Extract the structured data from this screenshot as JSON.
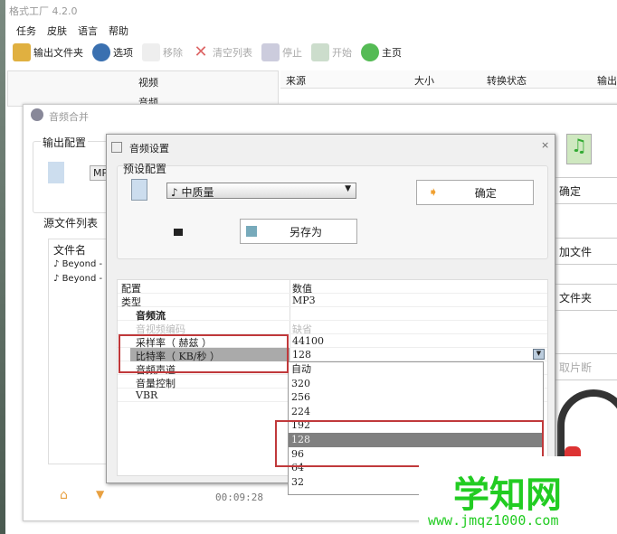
{
  "app": {
    "title": "格式工厂 4.2.0",
    "menu": [
      "任务",
      "皮肤",
      "语言",
      "帮助"
    ],
    "toolbar": {
      "output_folder": "输出文件夹",
      "options": "选项",
      "remove": "移除",
      "clear_list": "清空列表",
      "stop": "停止",
      "start": "开始",
      "home": "主页"
    },
    "left_pane": {
      "video": "视频",
      "audio": "音频"
    },
    "table_headers": [
      "来源",
      "大小",
      "转换状态",
      "输出"
    ]
  },
  "merge": {
    "title": "音频合并",
    "output_config": "输出配置",
    "format_short": "MP",
    "source_list": "源文件列表",
    "file_name_header": "文件名",
    "files": [
      "Beyond -",
      "Beyond -"
    ],
    "duration": "00:09:28",
    "right_buttons": [
      "确定",
      "加文件",
      "文件夹",
      "取片断"
    ]
  },
  "dialog": {
    "title": "音频设置",
    "close": "×",
    "preset_group": "预设配置",
    "preset_value": "♪ 中质量",
    "ok": "确定",
    "save_as": "另存为",
    "grid": {
      "header": [
        "配置",
        "数值"
      ],
      "rows": [
        {
          "name": "类型",
          "value": "MP3"
        },
        {
          "name": "音频流",
          "value": ""
        },
        {
          "name": "音视频编码",
          "value": "缺省"
        },
        {
          "name": "采样率（ 赫兹 ）",
          "value": "44100"
        },
        {
          "name": "比特率（ KB/秒 ）",
          "value": "128"
        },
        {
          "name": "音频声道",
          "value": "自动"
        },
        {
          "name": "音量控制",
          "value": ""
        },
        {
          "name": "VBR",
          "value": ""
        }
      ]
    },
    "bitrate_options": [
      "自动",
      "320",
      "256",
      "224",
      "192",
      "128",
      "96",
      "64",
      "32"
    ],
    "bitrate_selected": "128"
  },
  "watermark": {
    "name": "学知网",
    "url": "www.jmqz1000.com"
  },
  "colors": {
    "highlight_box": "#c0393b",
    "watermark": "#22cc22",
    "selected": "#808080"
  }
}
